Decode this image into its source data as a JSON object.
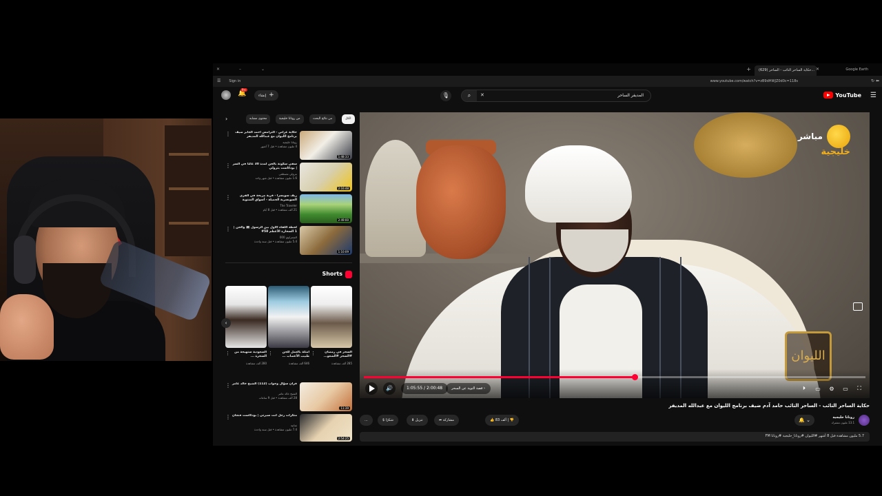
{
  "browser": {
    "tab_title": "(629) حكاية الساحر التائب - الساحر...",
    "profile_label": "Google Earth",
    "signin_label": "Sign in",
    "url": "www.youtube.com/watch?v=zB9dHWJZ0d0c=118s"
  },
  "header": {
    "create_label": "إنشاء",
    "notification_count": "9+",
    "search_query": "المديفر الساحر",
    "logo_text": "YouTube"
  },
  "player": {
    "channel_watermark_live": "مباشر",
    "channel_watermark_name": "خليجية",
    "emblem_text": "الليوان",
    "time_current": "1:05:55",
    "time_total": "2:00:48",
    "chapter": "قصة التوبة عن السحر",
    "progress_fraction": 0.54
  },
  "video": {
    "title": "حكاية الساحر التائب - الساحر التائب حامد آدم ضيف برنامج الليوان مع عبدالله المديفر",
    "channel_name": "روتانا خليجية",
    "channel_subs": "13.1 مليون مشترك",
    "likes": "83 ألف",
    "share_label": "مشاركة",
    "download_label": "تنزيل",
    "thanks_label": "شكرًا",
    "more_label": "...",
    "description": "5.7 مليون مشاهدة قبل 8 أشهر  #الليوان #روتانا_خليجية #روتانا FM"
  },
  "chips": [
    "الكل",
    "من نتائج البحث",
    "من روتانا خليجية",
    "محتوى مشابه"
  ],
  "recommendations": [
    {
      "title": "حكاية عراص - الترامس أحمد الجابر ضيف برنامج الليوان مع عبدالله المديفر",
      "channel": "روتانا خليجية",
      "meta": "4 مليون مشاهدة • قبل 7 أشهر",
      "duration": "1:48:33"
    },
    {
      "title": "سقي سكونة بالجن لمدة 30 عامًا في السر | بودكاست بترولي",
      "channel": "بترولي مصطفى",
      "meta": "1.6 مليون مشاهدة • قبل شهر واحد",
      "duration": "2:16:48"
    },
    {
      "title": "ريف سويسرا - قرية مريحة في القرى السويسرية الجميلة - أسواق الشتوية",
      "channel": "The Traveler",
      "meta": "21 ألف مشاهدة • قبل 8 أيام",
      "duration": "2:49:00"
    },
    {
      "title": "لحظة اللقاء الأول بين الرسول ﷺ والجن | 1 السحارة الأعظم 58#",
      "channel": "الشعراوي 000",
      "meta": "5.4 مليون مشاهدة • قبل سنة واحدة",
      "duration": "1:10:09"
    },
    {
      "title": "قرآن سؤال وجواب (112) الشيخ خالد عامر",
      "channel": "الشيخ خالد عامر",
      "meta": "28 ألف مشاهدة • قبل 9 ساعات",
      "duration": "11:39"
    },
    {
      "title": "متكرات رجل أنت سيرتي | بودكاست فنجان",
      "channel": "ثمانية",
      "meta": "7.4 مليون مشاهدة • قبل سنة واحدة",
      "duration": "2:54:25"
    }
  ],
  "shorts_label": "Shorts",
  "shorts": [
    {
      "title": "السحر في رمضان #السحر #الشعو...",
      "views": "285 ألف مشاهدة"
    },
    {
      "title": "أمثلة بالعمل للجن طبيب الأعصاب ...",
      "views": "646 ألف مشاهدة"
    },
    {
      "title": "السعودية ستهيجة من السحرة ...",
      "views": "280 ألف مشاهدة"
    }
  ],
  "colors": {
    "accent": "#ff0033",
    "bg": "#0f0f0f",
    "chip": "#272727",
    "watermark": "#f2b01c"
  }
}
